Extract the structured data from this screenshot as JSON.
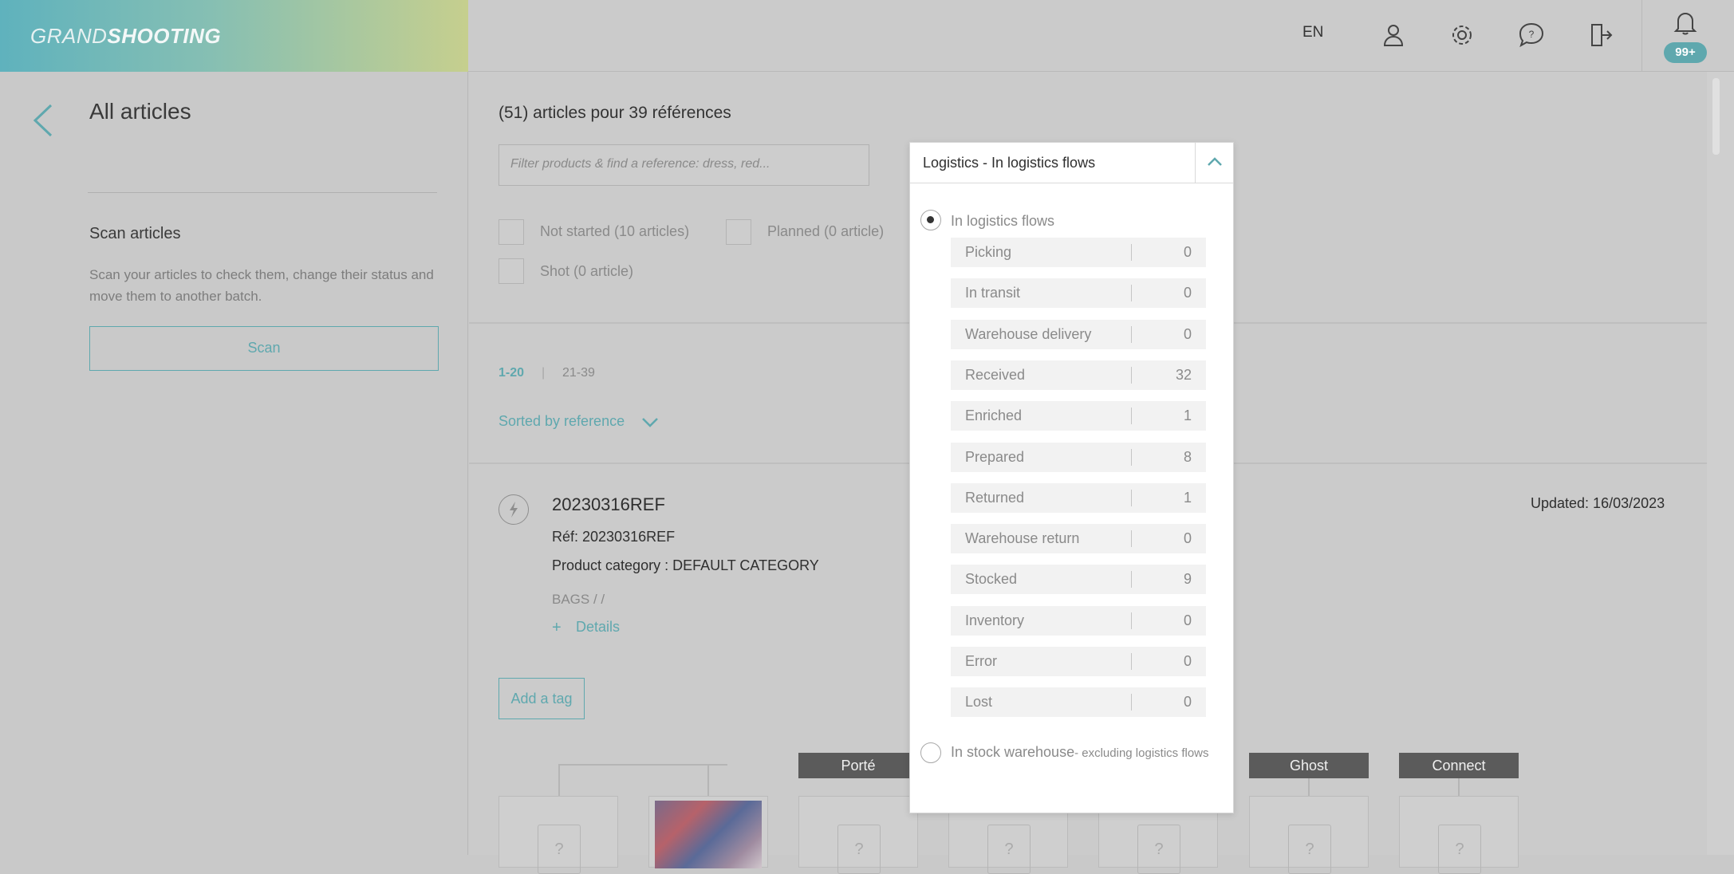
{
  "header": {
    "brand_light": "GRAND",
    "brand_bold": "SHOOTING",
    "language": "EN",
    "icons": [
      "user-icon",
      "gear-icon",
      "help-icon",
      "logout-icon",
      "bell-icon"
    ],
    "notifications_badge": "99+"
  },
  "sidebar": {
    "title": "All articles",
    "scan_title": "Scan articles",
    "scan_description": "Scan your articles to check them, change their status and move them to another batch.",
    "scan_button": "Scan"
  },
  "main": {
    "count_title": "(51) articles pour 39 références",
    "filter_placeholder": "Filter products & find a reference: dress, red...",
    "filters": {
      "not_started": "Not started (10 articles)",
      "planned": "Planned (0 article)",
      "shot": "Shot (0 article)"
    },
    "pagination": {
      "page1": "1-20",
      "separator": "|",
      "page2": "21-39"
    },
    "sort_label": "Sorted by reference",
    "article": {
      "title": "20230316REF",
      "ref": "Réf: 20230316REF",
      "category": "Product category : DEFAULT CATEGORY",
      "path": "BAGS / /",
      "details": "Details",
      "updated": "Updated: 16/03/2023",
      "add_tag": "Add a tag",
      "views": [
        "Porté",
        "Ghost",
        "Connect"
      ],
      "placeholder_glyph": "?"
    }
  },
  "dropdown": {
    "header_label": "Logistics - In logistics flows",
    "option1": "In logistics flows",
    "rows": [
      {
        "label": "Picking",
        "value": "0"
      },
      {
        "label": "In transit",
        "value": "0"
      },
      {
        "label": "Warehouse delivery",
        "value": "0"
      },
      {
        "label": "Received",
        "value": "32"
      },
      {
        "label": "Enriched",
        "value": "1"
      },
      {
        "label": "Prepared",
        "value": "8"
      },
      {
        "label": "Returned",
        "value": "1"
      },
      {
        "label": "Warehouse return",
        "value": "0"
      },
      {
        "label": "Stocked",
        "value": "9"
      },
      {
        "label": "Inventory",
        "value": "0"
      },
      {
        "label": "Error",
        "value": "0"
      },
      {
        "label": "Lost",
        "value": "0"
      }
    ],
    "option2": "In stock warehouse",
    "option2_suffix": "- excluding logistics flows"
  },
  "colors": {
    "accent": "#5fa8ae",
    "overlay": "#c9c9c9",
    "panel": "#ffffff"
  }
}
